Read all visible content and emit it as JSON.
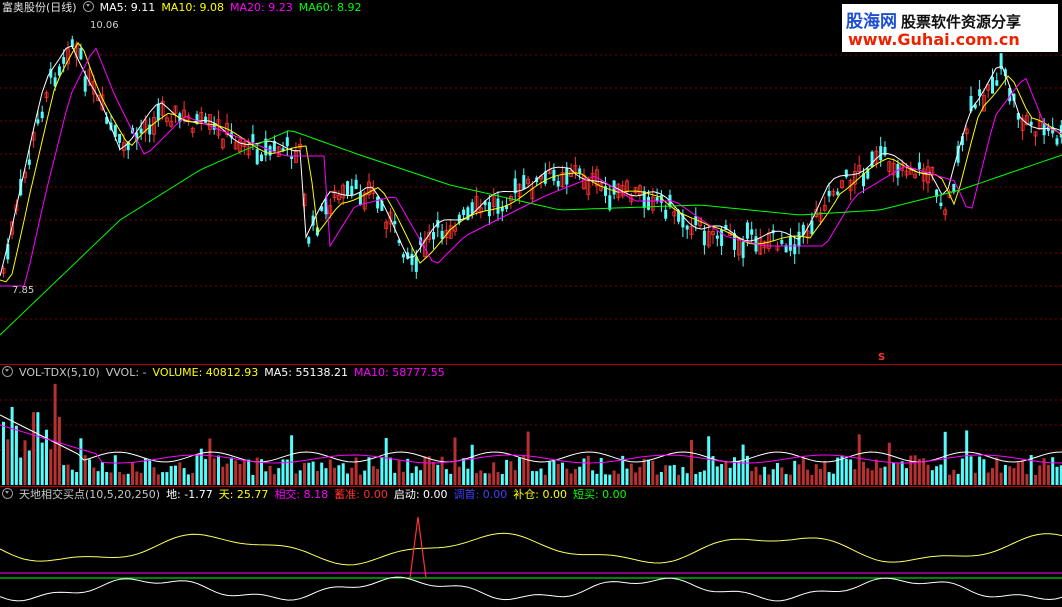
{
  "price": {
    "stock_name": "富奥股份(日线)",
    "ma_labels": [
      {
        "text": "MA5: 9.11",
        "color": "#ffffff"
      },
      {
        "text": "MA10: 9.08",
        "color": "#ffff00"
      },
      {
        "text": "MA20: 9.23",
        "color": "#ff00ff"
      },
      {
        "text": "MA60: 8.92",
        "color": "#00ff00"
      }
    ],
    "high_label": "10.06",
    "low_label": "7.85",
    "marker_label": "S"
  },
  "volume": {
    "labels": [
      {
        "text": "VOL-TDX(5,10)",
        "color": "#c8c8c8"
      },
      {
        "text": "VVOL: -",
        "color": "#c8c8c8"
      },
      {
        "text": "VOLUME: 40812.93",
        "color": "#ffff00"
      },
      {
        "text": "MA5: 55138.21",
        "color": "#ffffff"
      },
      {
        "text": "MA10: 58777.55",
        "color": "#ff00ff"
      }
    ]
  },
  "indicator": {
    "labels": [
      {
        "text": "天地相交买点(10,5,20,250)",
        "color": "#c8c8c8"
      },
      {
        "text": "地: -1.77",
        "color": "#ffffff"
      },
      {
        "text": "天: 25.77",
        "color": "#ffff00"
      },
      {
        "text": "相交: 8.18",
        "color": "#ff00ff"
      },
      {
        "text": "蓄准: 0.00",
        "color": "#ff3030"
      },
      {
        "text": "启动: 0.00",
        "color": "#ffffff"
      },
      {
        "text": "调首: 0.00",
        "color": "#4040ff"
      },
      {
        "text": "补仓: 0.00",
        "color": "#ffff00"
      },
      {
        "text": "短买: 0.00",
        "color": "#00ff00"
      }
    ]
  },
  "watermark": {
    "brand": "股海网",
    "tagline": "股票软件资源分享",
    "url": "www.Guhai.com.cn"
  },
  "colors": {
    "up": "#ff3232",
    "down": "#54fcfc",
    "grid": "#7a0000",
    "ma5": "#ffffff",
    "ma10": "#ffff00",
    "ma20": "#ff00ff",
    "ma60": "#00ff00"
  }
}
